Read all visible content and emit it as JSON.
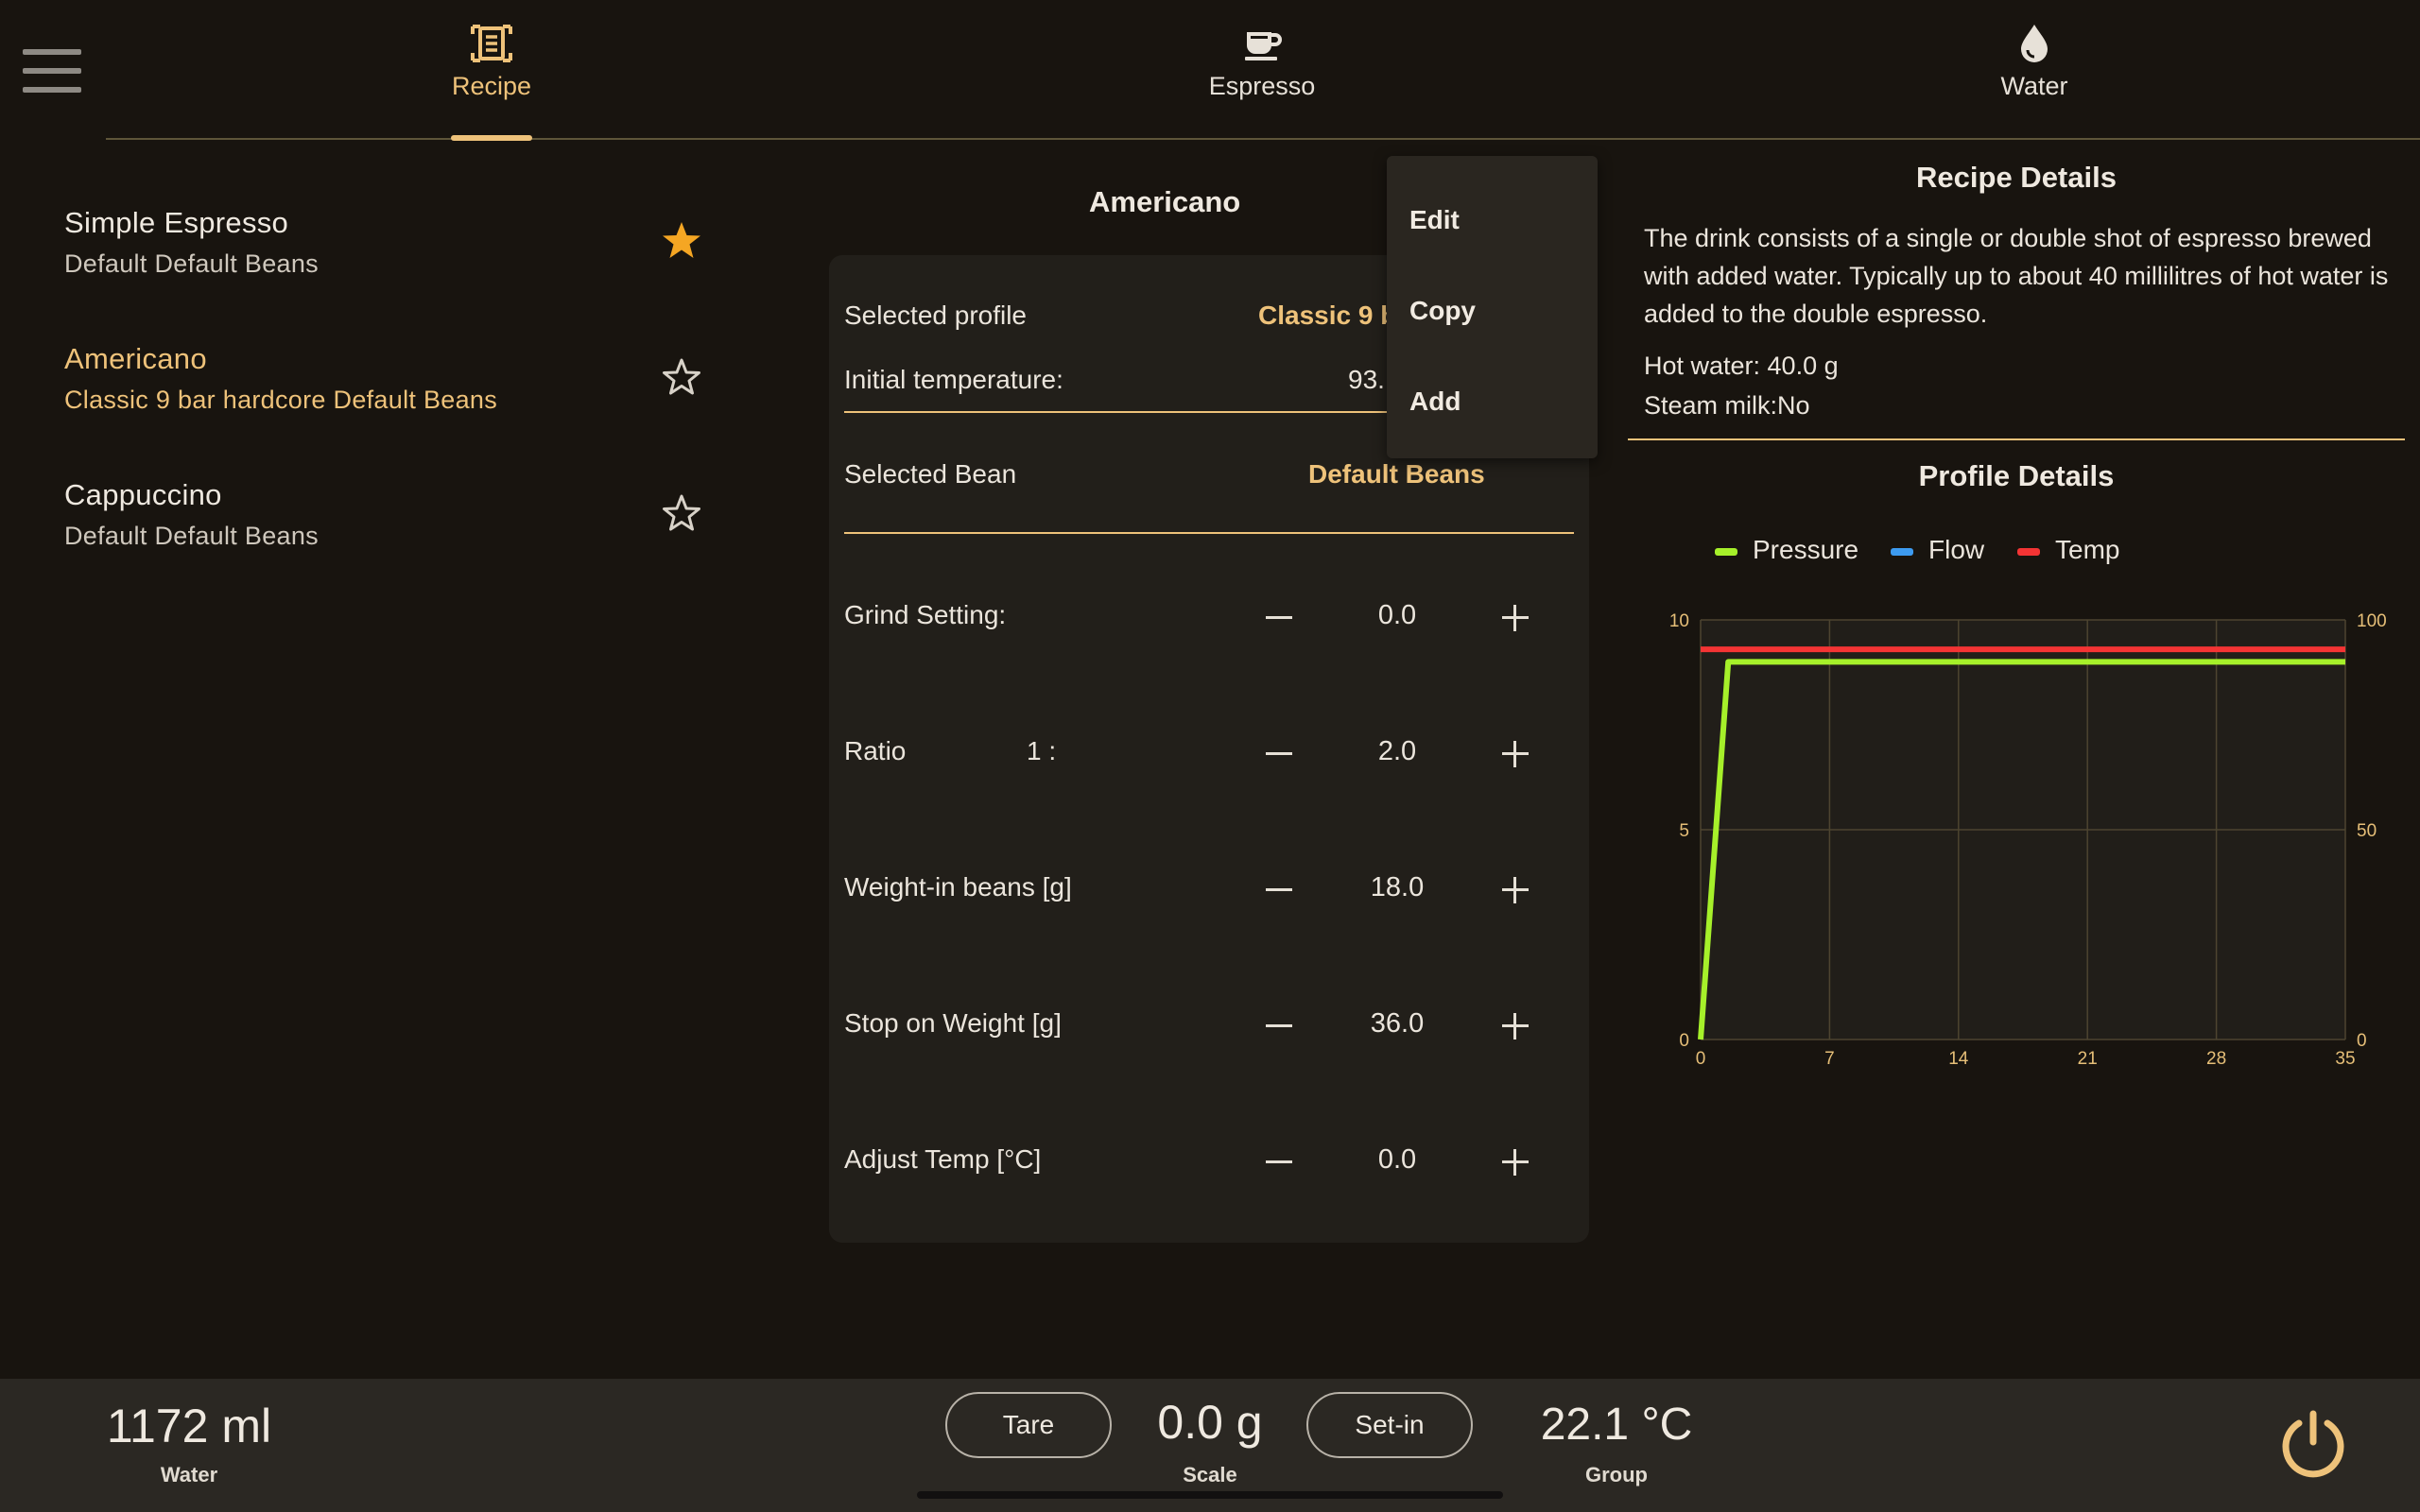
{
  "nav": {
    "tabs": [
      {
        "label": "Recipe",
        "icon": "recipe-icon",
        "active": true
      },
      {
        "label": "Espresso",
        "icon": "coffee-cup-icon",
        "active": false
      },
      {
        "label": "Water",
        "icon": "water-drop-icon",
        "active": false
      }
    ]
  },
  "recipes": [
    {
      "name": "Simple Espresso",
      "subtitle": "Default Default Beans",
      "favorite": true
    },
    {
      "name": "Americano",
      "subtitle": "Classic 9 bar hardcore Default Beans",
      "favorite": false,
      "selected": true
    },
    {
      "name": "Cappuccino",
      "subtitle": "Default Default Beans",
      "favorite": false
    }
  ],
  "center": {
    "title": "Americano",
    "selected_profile_label": "Selected profile",
    "selected_profile_value": "Classic 9 b",
    "initial_temp_label": "Initial temperature:",
    "initial_temp_value": "93.",
    "selected_bean_label": "Selected Bean",
    "selected_bean_value": "Default Beans",
    "ratio_prefix": "1 :",
    "steppers": [
      {
        "label": "Grind Setting:",
        "value": "0.0"
      },
      {
        "label": "Ratio",
        "value": "2.0"
      },
      {
        "label": "Weight-in beans [g]",
        "value": "18.0"
      },
      {
        "label": "Stop on Weight [g]",
        "value": "36.0"
      },
      {
        "label": "Adjust Temp [°C]",
        "value": "0.0"
      }
    ]
  },
  "menu": {
    "items": [
      "Edit",
      "Copy",
      "Add"
    ]
  },
  "recipe_details": {
    "title": "Recipe Details",
    "description": "The drink consists of a single or double shot of espresso brewed with added water. Typically up to about 40 millilitres of hot water is added to the double espresso.",
    "hot_water": "Hot water:  40.0 g",
    "steam_milk": "Steam milk:No"
  },
  "profile_details": {
    "title": "Profile Details"
  },
  "chart_data": {
    "type": "line",
    "legend": [
      {
        "name": "Pressure",
        "color": "#a6f02a"
      },
      {
        "name": "Flow",
        "color": "#3d9bf0"
      },
      {
        "name": "Temp",
        "color": "#f43434"
      }
    ],
    "x_ticks": [
      "0",
      "7",
      "14",
      "21",
      "28",
      "35"
    ],
    "y_left_ticks": [
      "0",
      "5",
      "10"
    ],
    "y_right_ticks": [
      "0",
      "50",
      "100"
    ],
    "xlim": [
      0,
      35
    ],
    "ylim_left": [
      0,
      10
    ],
    "ylim_right": [
      0,
      100
    ],
    "series": [
      {
        "name": "Pressure",
        "axis": "left",
        "x": [
          0,
          1.5,
          35
        ],
        "y": [
          0,
          9,
          9
        ]
      },
      {
        "name": "Temp",
        "axis": "right",
        "x": [
          0,
          35
        ],
        "y": [
          93,
          93
        ]
      }
    ],
    "grid": true
  },
  "bottom": {
    "water_value": "1172 ml",
    "water_label": "Water",
    "tare_label": "Tare",
    "scale_value": "0.0 g",
    "scale_label": "Scale",
    "setin_label": "Set-in",
    "group_value": "22.1 °C",
    "group_label": "Group"
  },
  "colors": {
    "accent": "#eec27a",
    "background": "#18140f",
    "favorite_star": "#f5a623"
  }
}
